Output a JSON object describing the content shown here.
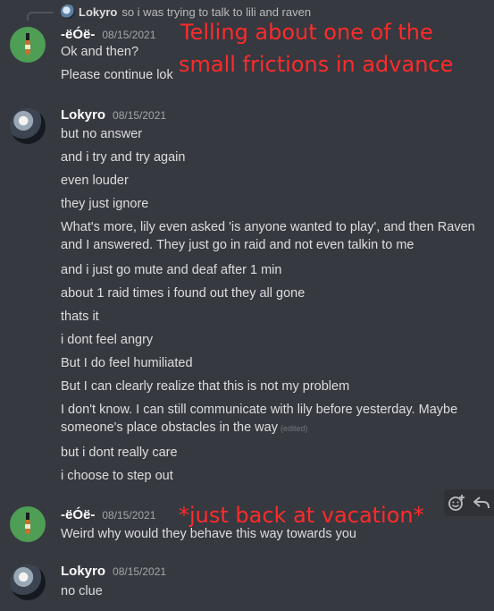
{
  "reply": {
    "author": "Lokyro",
    "text": "so i was trying to talk to lili and raven"
  },
  "messages": [
    {
      "author": "-ëÓë-",
      "timestamp": "08/15/2021",
      "avatar_icon": "bottle-icon",
      "lines": [
        "Ok and then?",
        "Please continue lok"
      ]
    },
    {
      "author": "Lokyro",
      "timestamp": "08/15/2021",
      "avatar_icon": "profile-photo",
      "lines": [
        "but no answer",
        "and i try and try again",
        "even louder",
        "they just ignore",
        "What's more, lily even asked 'is anyone wanted to play', and then Raven and I answered. They just go in raid and not even talkin to me",
        "and i just go mute and deaf after 1 min",
        "about 1 raid times i found out they all gone",
        "thats it",
        "i dont feel angry",
        "But I do feel humiliated",
        "But I can clearly realize that this is not my problem",
        "I don't know. I can still communicate with lily before yesterday. Maybe someone's place obstacles in the way",
        "but i dont really care",
        "i choose to step out"
      ],
      "edited_label": "(edited)"
    },
    {
      "author": "-ëÓë-",
      "timestamp": "08/15/2021",
      "avatar_icon": "bottle-icon",
      "lines": [
        "Weird why would they behave this way towards you"
      ]
    },
    {
      "author": "Lokyro",
      "timestamp": "08/15/2021",
      "avatar_icon": "profile-photo",
      "lines": [
        "no clue"
      ]
    }
  ],
  "annotations": {
    "top_line1": "Telling about one of the",
    "top_line2": "small frictions in advance",
    "middle": "*just back at vacation*"
  },
  "toolbar": {
    "icons": [
      "add-reaction-icon",
      "reply-icon"
    ]
  },
  "colors": {
    "background": "#36393f",
    "annotation": "#ff2b2b",
    "avatar_green": "#4e9e56"
  }
}
